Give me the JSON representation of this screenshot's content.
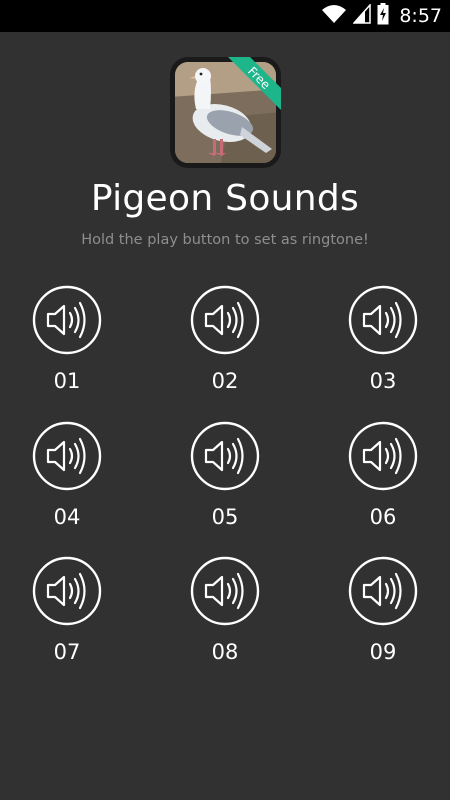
{
  "status_bar": {
    "time": "8:57",
    "icons": [
      "wifi-icon",
      "cellular-signal-icon",
      "battery-charging-icon"
    ]
  },
  "app": {
    "title": "Pigeon Sounds",
    "subtitle": "Hold the play button to set as ringtone!",
    "badge": "Free",
    "badge_color": "#1db58a",
    "background_color": "#313131"
  },
  "sounds": [
    {
      "label": "01",
      "icon": "speaker-icon"
    },
    {
      "label": "02",
      "icon": "speaker-icon"
    },
    {
      "label": "03",
      "icon": "speaker-icon"
    },
    {
      "label": "04",
      "icon": "speaker-icon"
    },
    {
      "label": "05",
      "icon": "speaker-icon"
    },
    {
      "label": "06",
      "icon": "speaker-icon"
    },
    {
      "label": "07",
      "icon": "speaker-icon"
    },
    {
      "label": "08",
      "icon": "speaker-icon"
    },
    {
      "label": "09",
      "icon": "speaker-icon"
    }
  ]
}
